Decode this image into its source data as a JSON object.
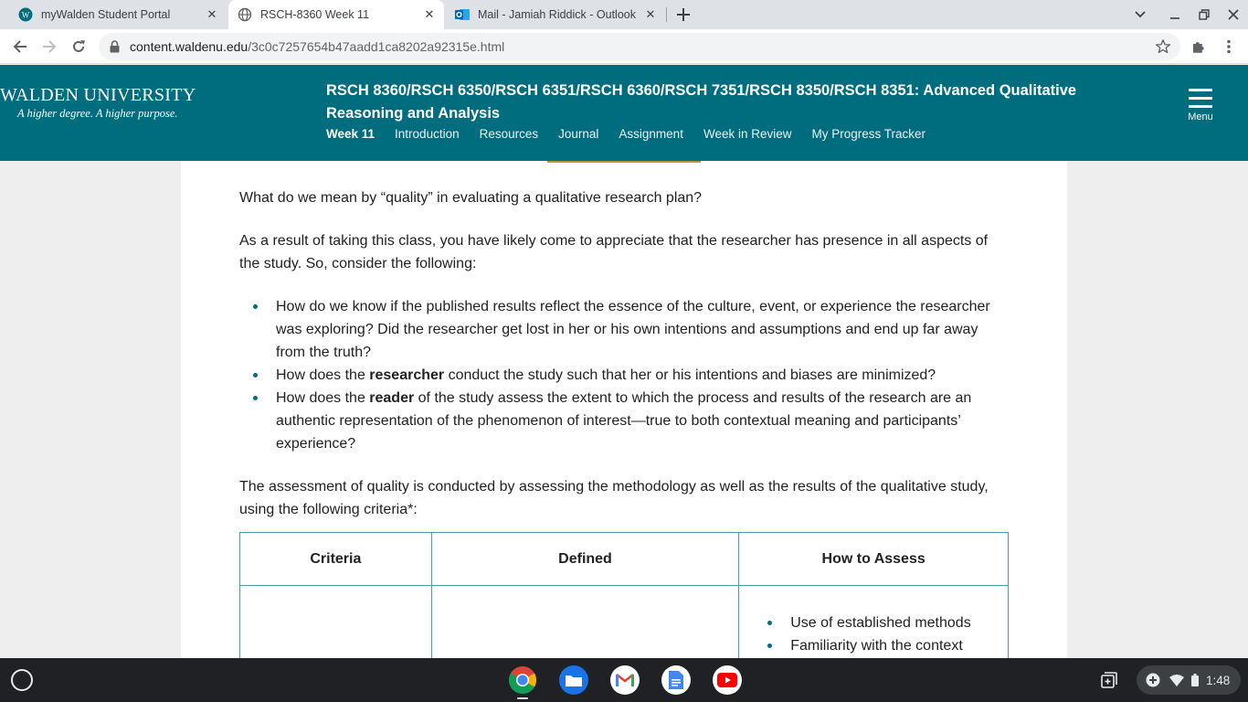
{
  "browser": {
    "tabs": [
      {
        "title": "myWalden Student Portal",
        "icon": "walden-w-icon",
        "active": false
      },
      {
        "title": "RSCH-8360 Week 11",
        "icon": "globe-icon",
        "active": true
      },
      {
        "title": "Mail - Jamiah Riddick - Outlook",
        "icon": "outlook-icon",
        "active": false
      }
    ],
    "url_domain": "content.waldenu.edu",
    "url_path": "/3c0c7257654b47aadd1ca8202a92315e.html"
  },
  "site": {
    "logo_name": "WALDEN UNIVERSITY",
    "logo_tagline": "A higher degree. A higher purpose.",
    "course_title": "RSCH 8360/RSCH 6350/RSCH 6351/RSCH 6360/RSCH 7351/RSCH 8350/RSCH 8351: Advanced Qualitative Reasoning and Analysis",
    "nav": [
      "Week 11",
      "Introduction",
      "Resources",
      "Journal",
      "Assignment",
      "Week in Review",
      "My Progress Tracker"
    ],
    "menu_label": "Menu"
  },
  "article": {
    "p1": "What do we mean by “quality” in evaluating a qualitative research plan?",
    "p2": "As a result of taking this class, you have likely come to appreciate that the researcher has presence in all aspects of the study. So, consider the following:",
    "bullet1": "How do we know if the published results reflect the essence of the culture, event, or experience the researcher was exploring? Did the researcher get lost in her or his own intentions and assumptions and end up far away from the truth?",
    "bullet2_pre": "How does the ",
    "bullet2_bold": "researcher",
    "bullet2_post": " conduct the study such that her or his intentions and biases are minimized?",
    "bullet3_pre": "How does the ",
    "bullet3_bold": "reader",
    "bullet3_post": " of the study assess the extent to which the process and results of the research are an authentic representation of the phenomenon of interest—true to both contextual meaning and participants’ experience?",
    "p3": "The assessment of quality is conducted by assessing the methodology as well as the results of the qualitative study, using the following criteria*:",
    "table": {
      "headers": [
        "Criteria",
        "Defined",
        "How to Assess"
      ],
      "row1_assess": [
        "Use of established methods",
        "Familiarity with the context"
      ]
    }
  },
  "shelf": {
    "apps": [
      "chrome-icon",
      "files-icon",
      "gmail-icon",
      "docs-icon",
      "youtube-icon"
    ],
    "time": "1:48"
  }
}
